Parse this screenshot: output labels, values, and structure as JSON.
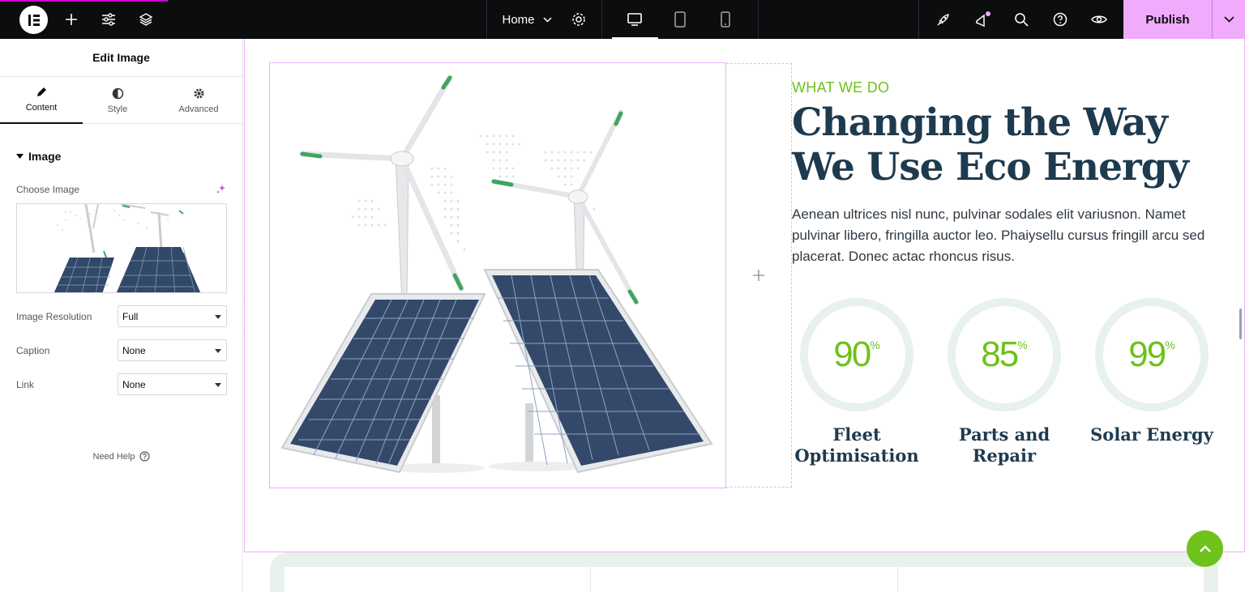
{
  "topbar": {
    "page_selector": "Home",
    "publish_label": "Publish"
  },
  "panel": {
    "title": "Edit Image",
    "tabs": [
      {
        "label": "Content",
        "icon": "pencil-icon"
      },
      {
        "label": "Style",
        "icon": "half-circle-icon"
      },
      {
        "label": "Advanced",
        "icon": "gear-icon"
      }
    ],
    "section_title": "Image",
    "choose_image_label": "Choose Image",
    "fields": [
      {
        "label": "Image Resolution",
        "value": "Full"
      },
      {
        "label": "Caption",
        "value": "None"
      },
      {
        "label": "Link",
        "value": "None"
      }
    ],
    "help_label": "Need Help"
  },
  "content": {
    "eyebrow": "WHAT WE DO",
    "headline": "Changing the Way We Use Eco Energy",
    "paragraph": "Aenean ultrices nisl nunc, pulvinar sodales elit variusnon. Namet pulvinar libero, fringilla auctor leo. Phaiysellu cursus fringill arcu sed placerat. Donec actac rhoncus risus.",
    "stats": [
      {
        "value": "90",
        "unit": "%",
        "label": "Fleet Optimisation"
      },
      {
        "value": "85",
        "unit": "%",
        "label": "Parts and Repair"
      },
      {
        "value": "99",
        "unit": "%",
        "label": "Solar Energy"
      }
    ]
  },
  "colors": {
    "accent": "#f0abfc",
    "green": "#6ec21b",
    "navy": "#1e3a4f"
  }
}
